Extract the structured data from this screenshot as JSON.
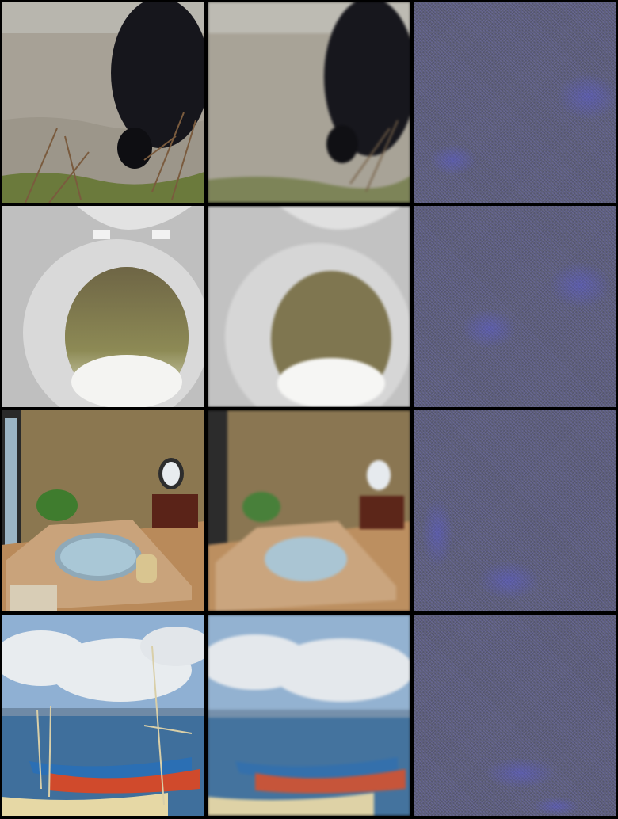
{
  "grid": {
    "columns": [
      "original",
      "reconstruction",
      "noise"
    ],
    "rows": [
      {
        "subject": "bear-grass",
        "colors": {
          "sky": "#b8b6ae",
          "fur": "#16161c",
          "ground": "#a7a196"
        }
      },
      {
        "subject": "toilet-cave",
        "colors": {
          "porcelain": "#d9d9d9",
          "rock": "#7d7348",
          "light": "#f4f4f2"
        }
      },
      {
        "subject": "bathroom-tub",
        "colors": {
          "wall": "#8b7750",
          "tub": "#a9c7d6",
          "counter": "#c9a37b",
          "cabinet": "#5a2318"
        }
      },
      {
        "subject": "harbor-boats",
        "colors": {
          "sky": "#8fb0d3",
          "cloud": "#e8ecef",
          "water": "#3f6f9c",
          "boat": "#2b6fb4"
        }
      }
    ],
    "noise_color": "#5f6078"
  }
}
